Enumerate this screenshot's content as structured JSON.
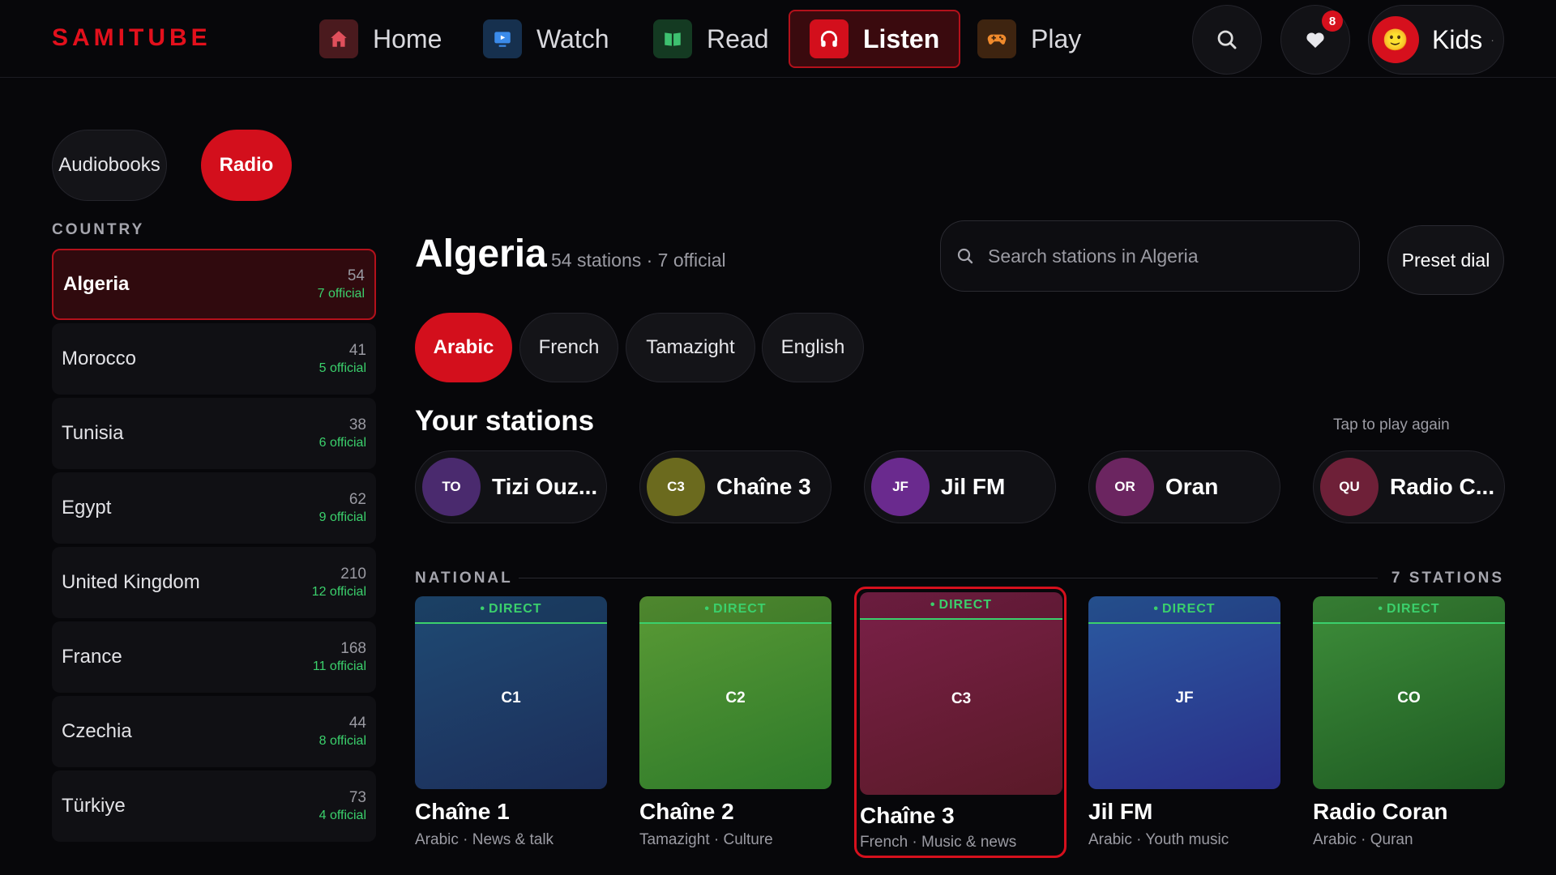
{
  "app": {
    "logo": "SAMITUBE"
  },
  "nav": [
    {
      "label": "Home",
      "icon": "home-icon",
      "color": "#e0505c"
    },
    {
      "label": "Watch",
      "icon": "tv-icon",
      "color": "#3b8bea"
    },
    {
      "label": "Read",
      "icon": "book-icon",
      "color": "#3ec070"
    },
    {
      "label": "Listen",
      "icon": "headphones-icon",
      "color": "#ffffff",
      "active": true
    },
    {
      "label": "Play",
      "icon": "gamepad-icon",
      "color": "#f08a2c"
    }
  ],
  "header": {
    "favorites_count": "8",
    "profile_name": "Kids",
    "profile_emoji": "🙂",
    "profile_dot": "·"
  },
  "modes": [
    {
      "label": "Audiobooks"
    },
    {
      "label": "Radio",
      "active": true
    }
  ],
  "sidebar": {
    "section_label": "COUNTRY",
    "countries": [
      {
        "name": "Algeria",
        "count": "54",
        "official": "7 official",
        "active": true
      },
      {
        "name": "Morocco",
        "count": "41",
        "official": "5 official"
      },
      {
        "name": "Tunisia",
        "count": "38",
        "official": "6 official"
      },
      {
        "name": "Egypt",
        "count": "62",
        "official": "9 official"
      },
      {
        "name": "United Kingdom",
        "count": "210",
        "official": "12 official"
      },
      {
        "name": "France",
        "count": "168",
        "official": "11 official"
      },
      {
        "name": "Czechia",
        "count": "44",
        "official": "8 official"
      },
      {
        "name": "Türkiye",
        "count": "73",
        "official": "4 official"
      }
    ]
  },
  "main": {
    "title": "Algeria",
    "subtitle": "54 stations · 7 official",
    "search_placeholder": "Search stations in Algeria",
    "preset_label": "Preset dial",
    "languages": [
      {
        "label": "Arabic",
        "active": true
      },
      {
        "label": "French"
      },
      {
        "label": "Tamazight"
      },
      {
        "label": "English"
      }
    ],
    "your_stations": {
      "title": "Your stations",
      "hint": "Tap to play again",
      "items": [
        {
          "initials": "TO",
          "name": "Tizi Ouz...",
          "color": "#4a2a6e"
        },
        {
          "initials": "C3",
          "name": "Chaîne 3",
          "color": "#6b6a1e"
        },
        {
          "initials": "JF",
          "name": "Jil FM",
          "color": "#6a2a8e"
        },
        {
          "initials": "OR",
          "name": "Oran",
          "color": "#6b2560"
        },
        {
          "initials": "QU",
          "name": "Radio C...",
          "color": "#6e2038"
        }
      ]
    },
    "national": {
      "label": "NATIONAL",
      "count": "7 STATIONS",
      "stations": [
        {
          "code": "C1",
          "title": "Chaîne 1",
          "subtitle": "Arabic · News & talk",
          "live": "DIRECT",
          "colors": [
            "#1f4a73",
            "#1c2e5a"
          ]
        },
        {
          "code": "C2",
          "title": "Chaîne 2",
          "subtitle": "Tamazight · Culture",
          "live": "DIRECT",
          "colors": [
            "#5a9a35",
            "#2e7a2a"
          ]
        },
        {
          "code": "C3",
          "title": "Chaîne 3",
          "subtitle": "French · Music & news",
          "live": "DIRECT",
          "colors": [
            "#7a2048",
            "#5a1a28"
          ],
          "focused": true
        },
        {
          "code": "JF",
          "title": "Jil FM",
          "subtitle": "Arabic · Youth music",
          "live": "DIRECT",
          "colors": [
            "#2a5aa0",
            "#2a2e88"
          ]
        },
        {
          "code": "CO",
          "title": "Radio Coran",
          "subtitle": "Arabic · Quran",
          "live": "DIRECT",
          "colors": [
            "#3e8e3a",
            "#1e5a22"
          ]
        }
      ]
    }
  }
}
